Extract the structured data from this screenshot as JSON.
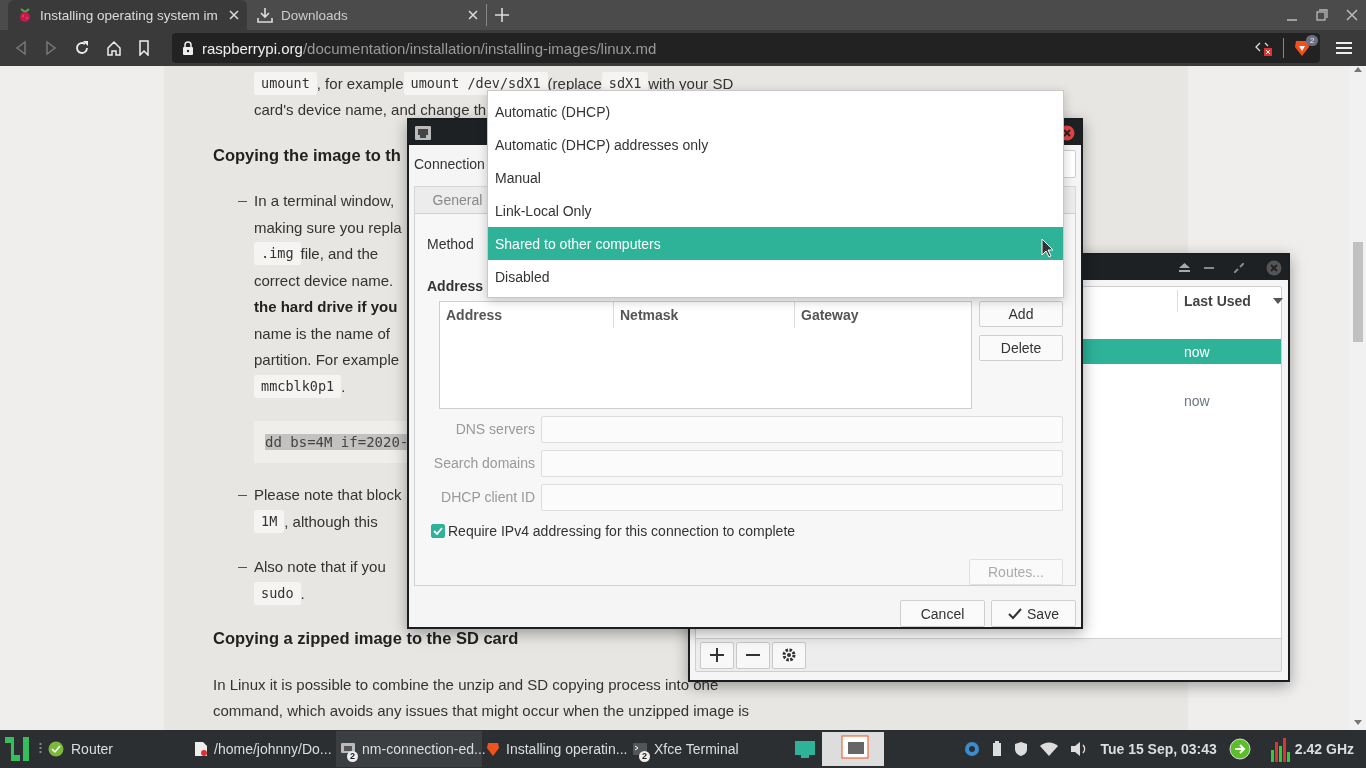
{
  "browser": {
    "tabs": [
      {
        "title": "Installing operating system im",
        "selected": true
      },
      {
        "title": "Downloads",
        "selected": false
      }
    ],
    "url_host": "raspberrypi.org",
    "url_path": "/documentation/installation/installing-images/linux.md",
    "shields_badge": "2"
  },
  "article": {
    "lines": [
      {
        "kind": "cont",
        "segments": [
          {
            "kind": "code",
            "text": "umount"
          },
          {
            "kind": "text",
            "text": ", for example "
          },
          {
            "kind": "code",
            "text": "umount /dev/sdX1"
          },
          {
            "kind": "text",
            "text": " (replace "
          },
          {
            "kind": "code",
            "text": "sdX1"
          },
          {
            "kind": "text",
            "text": " with your SD"
          }
        ]
      },
      {
        "kind": "cont",
        "segments": [
          {
            "kind": "text",
            "text": "card's device name, and change th"
          }
        ]
      },
      {
        "kind": "heading",
        "segments": [
          {
            "kind": "text",
            "text": "Copying the image to th"
          }
        ]
      },
      {
        "kind": "item",
        "segments": [
          {
            "kind": "text",
            "text": "In a terminal window,"
          }
        ]
      },
      {
        "kind": "cont",
        "segments": [
          {
            "kind": "text",
            "text": "making sure you repla"
          }
        ]
      },
      {
        "kind": "cont",
        "segments": [
          {
            "kind": "code",
            "text": ".img"
          },
          {
            "kind": "text",
            "text": " file, and the"
          }
        ]
      },
      {
        "kind": "cont",
        "segments": [
          {
            "kind": "text",
            "text": "correct device name."
          }
        ]
      },
      {
        "kind": "cont",
        "segments": [
          {
            "kind": "bold",
            "text": "the hard drive if you"
          }
        ]
      },
      {
        "kind": "cont",
        "segments": [
          {
            "kind": "text",
            "text": "name is the name of"
          }
        ]
      },
      {
        "kind": "cont",
        "segments": [
          {
            "kind": "text",
            "text": "partition. For example"
          }
        ]
      },
      {
        "kind": "cont",
        "segments": [
          {
            "kind": "code",
            "text": "mmcblk0p1"
          },
          {
            "kind": "text",
            "text": "."
          }
        ]
      },
      {
        "kind": "code_block",
        "highlighted": true,
        "text": "dd bs=4M if=2020-"
      },
      {
        "kind": "item",
        "segments": [
          {
            "kind": "text",
            "text": "Please note that block"
          }
        ]
      },
      {
        "kind": "cont",
        "segments": [
          {
            "kind": "code",
            "text": "1M"
          },
          {
            "kind": "text",
            "text": ", although this"
          }
        ]
      },
      {
        "kind": "item",
        "segments": [
          {
            "kind": "text",
            "text": "Also note that if you"
          }
        ]
      },
      {
        "kind": "cont",
        "segments": [
          {
            "kind": "code",
            "text": "sudo"
          },
          {
            "kind": "text",
            "text": "."
          }
        ]
      },
      {
        "kind": "heading",
        "segments": [
          {
            "kind": "text",
            "text": "Copying a zipped image to the SD card"
          }
        ]
      },
      {
        "kind": "para",
        "segments": [
          {
            "kind": "text",
            "text": "In Linux it is possible to combine the unzip and SD copying process into one"
          }
        ]
      },
      {
        "kind": "cont_para",
        "segments": [
          {
            "kind": "text",
            "text": "command, which avoids any issues that might occur when the unzipped image is"
          }
        ]
      }
    ]
  },
  "connections_window": {
    "column": "Last Used",
    "rows": [
      {
        "last_used": "now",
        "selected": true
      },
      {
        "last_used": "now",
        "selected": false
      }
    ]
  },
  "editor_dialog": {
    "connection_label": "Connection",
    "tabs": [
      {
        "label": "General",
        "selected": false
      }
    ],
    "method_label": "Method",
    "address_label": "Address",
    "address_columns": [
      "Address",
      "Netmask",
      "Gateway"
    ],
    "side_buttons": [
      {
        "label": "Add",
        "disabled": false
      },
      {
        "label": "Delete",
        "disabled": false
      }
    ],
    "fields": [
      {
        "label": "DNS servers",
        "disabled": true
      },
      {
        "label": "Search domains",
        "disabled": true
      },
      {
        "label": "DHCP client ID",
        "disabled": true
      }
    ],
    "require_ipv4": {
      "label": "Require IPv4 addressing for this connection to complete",
      "checked": true
    },
    "routes_button": {
      "label": "Routes...",
      "disabled": true
    },
    "buttons": [
      {
        "label": "Cancel",
        "kind": "plain"
      },
      {
        "label": "Save",
        "kind": "confirm"
      }
    ]
  },
  "method_menu": {
    "items": [
      {
        "label": "Automatic (DHCP)",
        "selected": false
      },
      {
        "label": "Automatic (DHCP) addresses only",
        "selected": false
      },
      {
        "label": "Manual",
        "selected": false
      },
      {
        "label": "Link-Local Only",
        "selected": false
      },
      {
        "label": "Shared to other computers",
        "selected": true
      },
      {
        "label": "Disabled",
        "selected": false
      }
    ]
  },
  "taskbar": {
    "launcher_label": "Router",
    "tasks": [
      {
        "label": "/home/johnny/Do...",
        "kind": "files",
        "selected": false
      },
      {
        "label": "nm-connection-ed...",
        "kind": "network",
        "badge": "2",
        "selected": true
      },
      {
        "label": "Installing operatin...",
        "kind": "browser",
        "selected": false
      },
      {
        "label": "Xfce Terminal",
        "kind": "terminal",
        "badge": "2",
        "selected": false
      }
    ],
    "clock": "Tue 15 Sep, 03:43",
    "cpu": "2.42 GHz"
  }
}
